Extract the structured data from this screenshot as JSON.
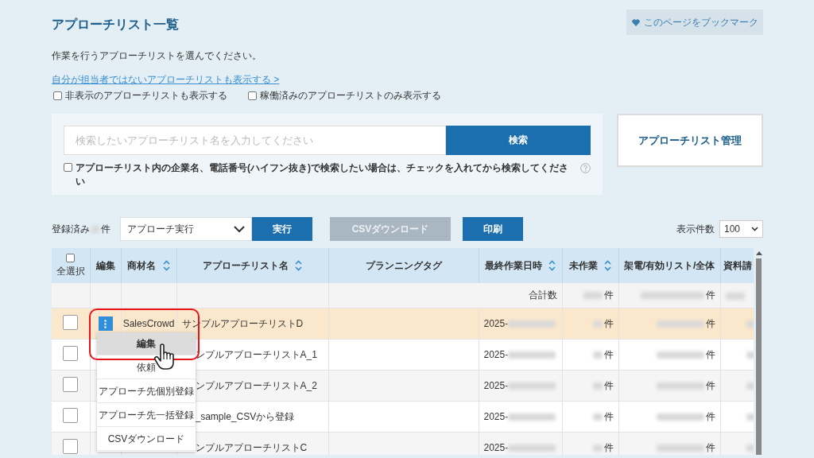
{
  "page": {
    "title": "アプローチリスト一覧",
    "bookmark_button": "このページをブックマーク",
    "instruction": "作業を行うアプローチリストを選んでください。",
    "show_others_link": "自分が担当者ではないアプローチリストも表示する >",
    "filters": [
      {
        "label": "非表示のアプローチリストも表示する",
        "checked": false
      },
      {
        "label": "稼働済みのアプローチリストのみ表示する",
        "checked": false
      }
    ]
  },
  "search": {
    "placeholder": "検索したいアプローチリスト名を入力してください",
    "button": "検索",
    "option": {
      "label": "アプローチリスト内の企業名、電話番号(ハイフン抜き)で検索したい場合は、チェックを入れてから検索してください",
      "checked": false
    }
  },
  "manage_button": "アプローチリスト管理",
  "toolbar": {
    "registered_label": "登録済み",
    "registered_unit": "件",
    "action_select": "アプローチ実行",
    "run_button": "実行",
    "csv_button": {
      "label": "CSVダウンロード",
      "disabled": true
    },
    "print_button": "印刷",
    "page_size_label": "表示件数",
    "page_size": "100"
  },
  "table": {
    "select_all": {
      "label": "全選択",
      "checked": false
    },
    "columns": [
      {
        "label": "編集",
        "sortable": false
      },
      {
        "label": "商材名",
        "sortable": true
      },
      {
        "label": "アプローチリスト名",
        "sortable": true
      },
      {
        "label": "プランニングタグ",
        "sortable": false
      },
      {
        "label": "最終作業日時",
        "sortable": true
      },
      {
        "label": "未作業",
        "sortable": true
      },
      {
        "label": "架電/有効リスト/全体",
        "sortable": false
      },
      {
        "label": "資料請",
        "sortable": false
      }
    ],
    "total_row": {
      "label": "合計数",
      "pending_unit": "件",
      "calls_unit": "件"
    },
    "rows": [
      {
        "checked": false,
        "selected": true,
        "product": "SalesCrowd",
        "name": "サンプルアプローチリストD",
        "date": "2025-",
        "pending_unit": "件",
        "calls_unit": "件"
      },
      {
        "checked": false,
        "selected": false,
        "name": "ンプルアプローチリストA_1",
        "date": "2025-",
        "pending_unit": "件",
        "calls_unit": "件"
      },
      {
        "checked": false,
        "selected": false,
        "name": "ンプルアプローチリストA_2",
        "date": "2025-",
        "pending_unit": "件",
        "calls_unit": "件"
      },
      {
        "checked": false,
        "selected": false,
        "name": "_sample_CSVから登録",
        "date": "2025-",
        "pending_unit": "件",
        "calls_unit": "件"
      },
      {
        "checked": false,
        "selected": false,
        "name": "ンプルアプローチリストC",
        "date": "2025-",
        "pending_unit": "件",
        "calls_unit": "件"
      }
    ]
  },
  "menu": {
    "items": [
      {
        "label": "編集",
        "selected": true
      },
      {
        "label": "依頼",
        "selected": false
      },
      {
        "label": "アプローチ先個別登録",
        "selected": false
      },
      {
        "label": "アプローチ先一括登録",
        "selected": false
      },
      {
        "label": "CSVダウンロード",
        "selected": false
      }
    ]
  }
}
